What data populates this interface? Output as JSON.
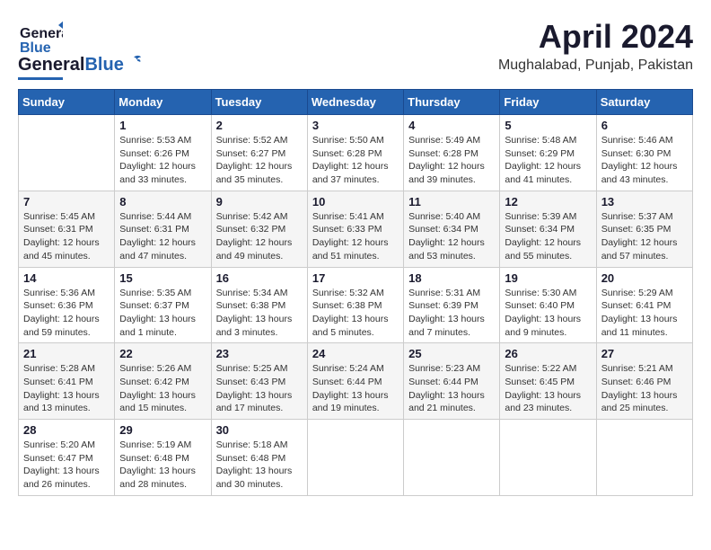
{
  "header": {
    "logo_general": "General",
    "logo_blue": "Blue",
    "month_title": "April 2024",
    "location": "Mughalabad, Punjab, Pakistan"
  },
  "days_of_week": [
    "Sunday",
    "Monday",
    "Tuesday",
    "Wednesday",
    "Thursday",
    "Friday",
    "Saturday"
  ],
  "weeks": [
    [
      {
        "day": "",
        "info": ""
      },
      {
        "day": "1",
        "info": "Sunrise: 5:53 AM\nSunset: 6:26 PM\nDaylight: 12 hours\nand 33 minutes."
      },
      {
        "day": "2",
        "info": "Sunrise: 5:52 AM\nSunset: 6:27 PM\nDaylight: 12 hours\nand 35 minutes."
      },
      {
        "day": "3",
        "info": "Sunrise: 5:50 AM\nSunset: 6:28 PM\nDaylight: 12 hours\nand 37 minutes."
      },
      {
        "day": "4",
        "info": "Sunrise: 5:49 AM\nSunset: 6:28 PM\nDaylight: 12 hours\nand 39 minutes."
      },
      {
        "day": "5",
        "info": "Sunrise: 5:48 AM\nSunset: 6:29 PM\nDaylight: 12 hours\nand 41 minutes."
      },
      {
        "day": "6",
        "info": "Sunrise: 5:46 AM\nSunset: 6:30 PM\nDaylight: 12 hours\nand 43 minutes."
      }
    ],
    [
      {
        "day": "7",
        "info": "Sunrise: 5:45 AM\nSunset: 6:31 PM\nDaylight: 12 hours\nand 45 minutes."
      },
      {
        "day": "8",
        "info": "Sunrise: 5:44 AM\nSunset: 6:31 PM\nDaylight: 12 hours\nand 47 minutes."
      },
      {
        "day": "9",
        "info": "Sunrise: 5:42 AM\nSunset: 6:32 PM\nDaylight: 12 hours\nand 49 minutes."
      },
      {
        "day": "10",
        "info": "Sunrise: 5:41 AM\nSunset: 6:33 PM\nDaylight: 12 hours\nand 51 minutes."
      },
      {
        "day": "11",
        "info": "Sunrise: 5:40 AM\nSunset: 6:34 PM\nDaylight: 12 hours\nand 53 minutes."
      },
      {
        "day": "12",
        "info": "Sunrise: 5:39 AM\nSunset: 6:34 PM\nDaylight: 12 hours\nand 55 minutes."
      },
      {
        "day": "13",
        "info": "Sunrise: 5:37 AM\nSunset: 6:35 PM\nDaylight: 12 hours\nand 57 minutes."
      }
    ],
    [
      {
        "day": "14",
        "info": "Sunrise: 5:36 AM\nSunset: 6:36 PM\nDaylight: 12 hours\nand 59 minutes."
      },
      {
        "day": "15",
        "info": "Sunrise: 5:35 AM\nSunset: 6:37 PM\nDaylight: 13 hours\nand 1 minute."
      },
      {
        "day": "16",
        "info": "Sunrise: 5:34 AM\nSunset: 6:38 PM\nDaylight: 13 hours\nand 3 minutes."
      },
      {
        "day": "17",
        "info": "Sunrise: 5:32 AM\nSunset: 6:38 PM\nDaylight: 13 hours\nand 5 minutes."
      },
      {
        "day": "18",
        "info": "Sunrise: 5:31 AM\nSunset: 6:39 PM\nDaylight: 13 hours\nand 7 minutes."
      },
      {
        "day": "19",
        "info": "Sunrise: 5:30 AM\nSunset: 6:40 PM\nDaylight: 13 hours\nand 9 minutes."
      },
      {
        "day": "20",
        "info": "Sunrise: 5:29 AM\nSunset: 6:41 PM\nDaylight: 13 hours\nand 11 minutes."
      }
    ],
    [
      {
        "day": "21",
        "info": "Sunrise: 5:28 AM\nSunset: 6:41 PM\nDaylight: 13 hours\nand 13 minutes."
      },
      {
        "day": "22",
        "info": "Sunrise: 5:26 AM\nSunset: 6:42 PM\nDaylight: 13 hours\nand 15 minutes."
      },
      {
        "day": "23",
        "info": "Sunrise: 5:25 AM\nSunset: 6:43 PM\nDaylight: 13 hours\nand 17 minutes."
      },
      {
        "day": "24",
        "info": "Sunrise: 5:24 AM\nSunset: 6:44 PM\nDaylight: 13 hours\nand 19 minutes."
      },
      {
        "day": "25",
        "info": "Sunrise: 5:23 AM\nSunset: 6:44 PM\nDaylight: 13 hours\nand 21 minutes."
      },
      {
        "day": "26",
        "info": "Sunrise: 5:22 AM\nSunset: 6:45 PM\nDaylight: 13 hours\nand 23 minutes."
      },
      {
        "day": "27",
        "info": "Sunrise: 5:21 AM\nSunset: 6:46 PM\nDaylight: 13 hours\nand 25 minutes."
      }
    ],
    [
      {
        "day": "28",
        "info": "Sunrise: 5:20 AM\nSunset: 6:47 PM\nDaylight: 13 hours\nand 26 minutes."
      },
      {
        "day": "29",
        "info": "Sunrise: 5:19 AM\nSunset: 6:48 PM\nDaylight: 13 hours\nand 28 minutes."
      },
      {
        "day": "30",
        "info": "Sunrise: 5:18 AM\nSunset: 6:48 PM\nDaylight: 13 hours\nand 30 minutes."
      },
      {
        "day": "",
        "info": ""
      },
      {
        "day": "",
        "info": ""
      },
      {
        "day": "",
        "info": ""
      },
      {
        "day": "",
        "info": ""
      }
    ]
  ]
}
